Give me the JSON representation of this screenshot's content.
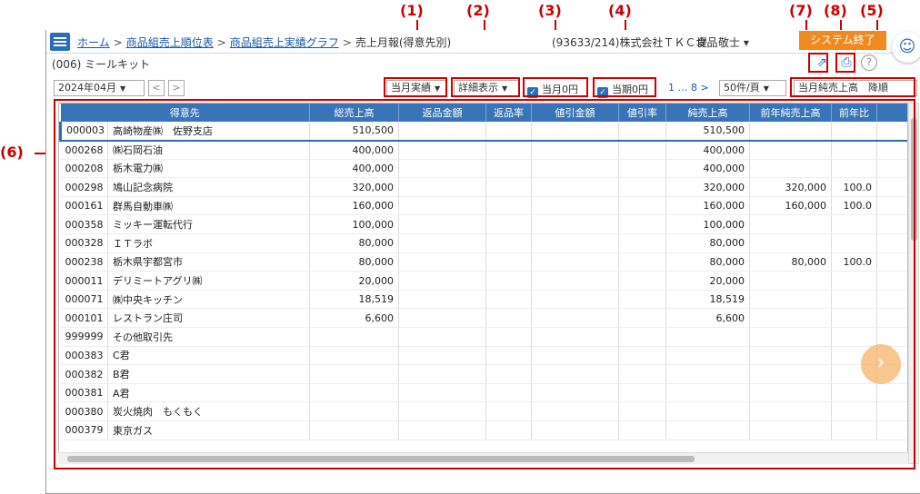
{
  "markers": [
    "(1)",
    "(2)",
    "(3)",
    "(4)",
    "(7)",
    "(8)",
    "(5)",
    "(6)"
  ],
  "header": {
    "breadcrumbs": [
      "ホーム",
      "商品組売上順位表",
      "商品組売上実績グラフ"
    ],
    "current_page": "売上月報(得意先別)",
    "separator": ">",
    "company": "(93633/214)株式会社ＴＫＣ食品",
    "user": "堤　敬士 ▾",
    "system_end_label": "システム終了"
  },
  "subtitle": "(006) ミールキット",
  "toolbar": {
    "period": "2024年04月",
    "actual_mode": "当月実績",
    "detail_mode": "詳細表示",
    "month_zero": "当月0円",
    "period_zero": "当期0円",
    "pager": "1 … 8 >",
    "page_size": "50件/頁",
    "sort": "当月純売上高　降順"
  },
  "table": {
    "columns": [
      "得意先",
      "総売上高",
      "返品金額",
      "返品率",
      "値引金額",
      "値引率",
      "純売上高",
      "前年純売上高",
      "前年比"
    ],
    "rows": [
      {
        "code": "000003",
        "name": "高崎物産㈱　佐野支店",
        "total": "510,500",
        "net": "510,500",
        "prev": "",
        "ratio": ""
      },
      {
        "code": "000268",
        "name": "㈱石岡石油",
        "total": "400,000",
        "net": "400,000",
        "prev": "",
        "ratio": ""
      },
      {
        "code": "000208",
        "name": "栃木電力㈱",
        "total": "400,000",
        "net": "400,000",
        "prev": "",
        "ratio": ""
      },
      {
        "code": "000298",
        "name": "鳩山記念病院",
        "total": "320,000",
        "net": "320,000",
        "prev": "320,000",
        "ratio": "100.0"
      },
      {
        "code": "000161",
        "name": "群馬自動車㈱",
        "total": "160,000",
        "net": "160,000",
        "prev": "160,000",
        "ratio": "100.0"
      },
      {
        "code": "000358",
        "name": "ミッキー運転代行",
        "total": "100,000",
        "net": "100,000",
        "prev": "",
        "ratio": ""
      },
      {
        "code": "000328",
        "name": "ＩＴラボ",
        "total": "80,000",
        "net": "80,000",
        "prev": "",
        "ratio": ""
      },
      {
        "code": "000238",
        "name": "栃木県宇都宮市",
        "total": "80,000",
        "net": "80,000",
        "prev": "80,000",
        "ratio": "100.0"
      },
      {
        "code": "000011",
        "name": "デリミートアグリ㈱",
        "total": "20,000",
        "net": "20,000",
        "prev": "",
        "ratio": ""
      },
      {
        "code": "000071",
        "name": "㈱中央キッチン",
        "total": "18,519",
        "net": "18,519",
        "prev": "",
        "ratio": ""
      },
      {
        "code": "000101",
        "name": "レストラン庄司",
        "total": "6,600",
        "net": "6,600",
        "prev": "",
        "ratio": ""
      },
      {
        "code": "999999",
        "name": "その他取引先",
        "total": "",
        "net": "",
        "prev": "",
        "ratio": ""
      },
      {
        "code": "000383",
        "name": "C君",
        "total": "",
        "net": "",
        "prev": "",
        "ratio": ""
      },
      {
        "code": "000382",
        "name": "B君",
        "total": "",
        "net": "",
        "prev": "",
        "ratio": ""
      },
      {
        "code": "000381",
        "name": "A君",
        "total": "",
        "net": "",
        "prev": "",
        "ratio": ""
      },
      {
        "code": "000380",
        "name": "炭火焼肉　もくもく",
        "total": "",
        "net": "",
        "prev": "",
        "ratio": ""
      },
      {
        "code": "000379",
        "name": "東京ガス",
        "total": "",
        "net": "",
        "prev": "",
        "ratio": ""
      }
    ]
  },
  "colors": {
    "accent": "#2a6fb5",
    "header_bg": "#3a74b8",
    "callout": "#cc0000",
    "system_end": "#f08a1f"
  }
}
